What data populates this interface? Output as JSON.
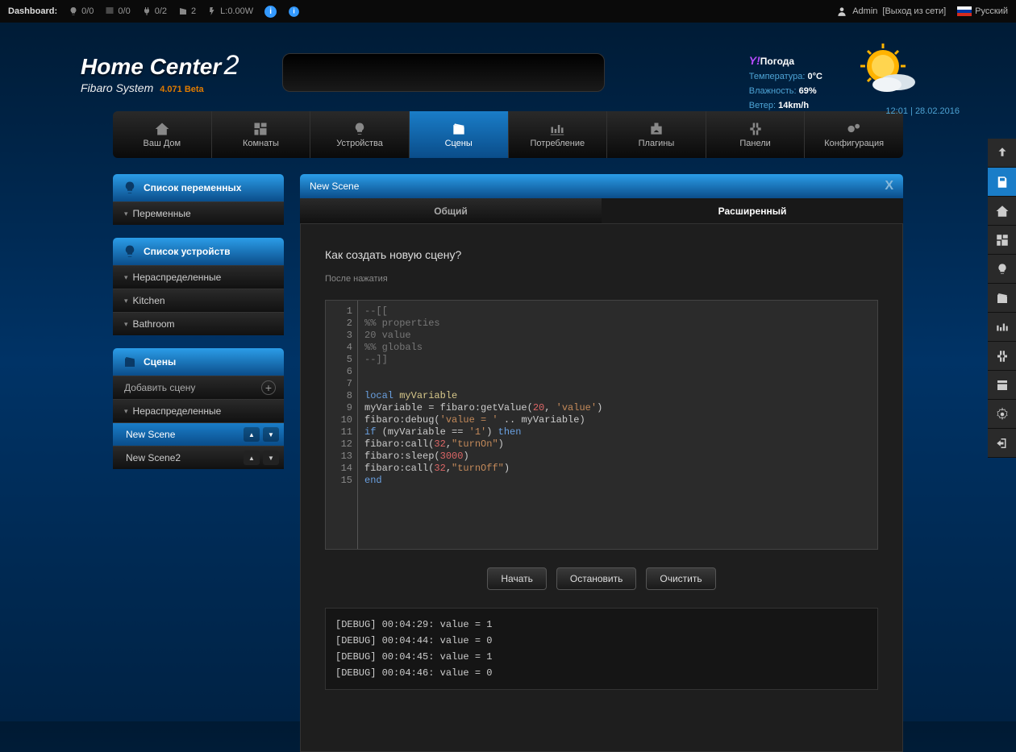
{
  "dashbar": {
    "label": "Dashboard:",
    "stats": {
      "lights": "0/0",
      "blinds": "0/0",
      "plugs": "0/2",
      "scenes": "2",
      "power": "L:0.00W"
    },
    "user": "Admin",
    "logout": "[Выход из сети]",
    "language": "Русский"
  },
  "brand": {
    "name": "Home Center",
    "two": "2",
    "system": "Fibaro System",
    "version": "4.071 Beta"
  },
  "weather": {
    "title": "Погода",
    "temp_label": "Температура:",
    "temp_value": "0°C",
    "humidity_label": "Влажность:",
    "humidity_value": "69%",
    "wind_label": "Ветер:",
    "wind_value": "14km/h"
  },
  "datetime": {
    "time": "12:01",
    "date": "28.02.2016"
  },
  "mainnav": [
    {
      "label": "Ваш Дом"
    },
    {
      "label": "Комнаты"
    },
    {
      "label": "Устройства"
    },
    {
      "label": "Сцены"
    },
    {
      "label": "Потребление"
    },
    {
      "label": "Плагины"
    },
    {
      "label": "Панели"
    },
    {
      "label": "Конфигурация"
    }
  ],
  "sidebar": {
    "variables_head": "Список переменных",
    "variables_item": "Переменные",
    "devices_head": "Список устройств",
    "devices_items": [
      "Нераспределенные",
      "Kitchen",
      "Bathroom"
    ],
    "scenes_head": "Сцены",
    "add_scene": "Добавить сцену",
    "scenes_group": "Нераспределенные",
    "scenes": [
      "New Scene",
      "New Scene2"
    ]
  },
  "main": {
    "title": "New Scene",
    "tabs": {
      "general": "Общий",
      "advanced": "Расширенный"
    },
    "heading": "Как создать новую сцену?",
    "subtext": "После нажатия",
    "code_lines": [
      {
        "n": 1,
        "html": "<span class='c-comment'>--[[</span>"
      },
      {
        "n": 2,
        "html": "<span class='c-comment'>%% properties</span>"
      },
      {
        "n": 3,
        "html": "<span class='c-comment'>20 value</span>"
      },
      {
        "n": 4,
        "html": "<span class='c-comment'>%% globals</span>"
      },
      {
        "n": 5,
        "html": "<span class='c-comment'>--]]</span>"
      },
      {
        "n": 6,
        "html": ""
      },
      {
        "n": 7,
        "html": ""
      },
      {
        "n": 8,
        "html": "<span class='c-kw'>local</span> <span class='c-id'>myVariable</span>"
      },
      {
        "n": 9,
        "html": "myVariable = fibaro:getValue(<span class='c-num'>20</span>, <span class='c-str'>'value'</span>)"
      },
      {
        "n": 10,
        "html": "fibaro:debug(<span class='c-str'>'value = '</span> .. myVariable)"
      },
      {
        "n": 11,
        "html": "<span class='c-kw'>if</span> (myVariable == <span class='c-str'>'1'</span>) <span class='c-kw'>then</span>"
      },
      {
        "n": 12,
        "html": "fibaro:call(<span class='c-num'>32</span>,<span class='c-str'>\"turnOn\"</span>)"
      },
      {
        "n": 13,
        "html": "fibaro:sleep(<span class='c-num'>3000</span>)"
      },
      {
        "n": 14,
        "html": "fibaro:call(<span class='c-num'>32</span>,<span class='c-str'>\"turnOff\"</span>)"
      },
      {
        "n": 15,
        "html": "<span class='c-kw'>end</span>"
      }
    ],
    "buttons": {
      "start": "Начать",
      "stop": "Остановить",
      "clear": "Очистить"
    },
    "debug": [
      "[DEBUG] 00:04:29: value = 1",
      "[DEBUG] 00:04:44: value = 0",
      "[DEBUG] 00:04:45: value = 1",
      "[DEBUG] 00:04:46: value = 0"
    ]
  }
}
